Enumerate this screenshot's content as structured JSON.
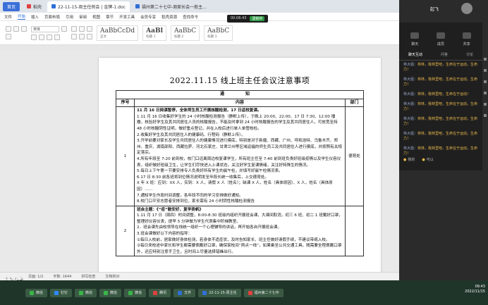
{
  "window": {
    "tabs": [
      {
        "label": "首页",
        "active": false,
        "color": "#3a6fd8"
      },
      {
        "label": "稻壳",
        "active": false,
        "color": "#e04040"
      },
      {
        "label": "22-11-15-周主任例会 | 金牌-1.doc",
        "active": true,
        "color": "#2f6fd8"
      },
      {
        "label": "福州第二十七中-周家长会一般主...",
        "active": false,
        "color": "#2f6fd8"
      }
    ],
    "menu": [
      "文件",
      "开始",
      "插入",
      "页面布局",
      "引用",
      "审阅",
      "视图",
      "章节",
      "开发工具",
      "会员专享",
      "稻壳资源",
      "查找命令"
    ],
    "active_menu": "开始",
    "font_name": "宋体",
    "styles": [
      {
        "sample": "AaBbCcDd",
        "label": "正文"
      },
      {
        "sample": "AaBl",
        "label": "标题 1"
      },
      {
        "sample": "AaBbC",
        "label": "标题 2"
      },
      {
        "sample": "AaBbC",
        "label": "标题 3"
      }
    ],
    "status": {
      "page": "页面: 1/2",
      "words": "字数: 1644",
      "check": "拼写检查",
      "mode": "文档校对"
    }
  },
  "document": {
    "title": "2022.11.15 线上班主任会议注意事项",
    "notice_header": "通 知",
    "columns": {
      "num": "序号",
      "content": "内容",
      "dept": "部门"
    },
    "rows": [
      {
        "num": "1",
        "dept": "德育处",
        "lines": [
          {
            "text": "11 月 16 日网课暂停，全体师生员工开展核酸检测，17 日返校复课。",
            "bold": true
          },
          {
            "text": "1.11 月 16 日收集好学生的 24 小时核酸检测报告（静默上传），于晚上 20:00、22:00、17 日 7:30、12:00 播撒，核验好学生及其共同居住人员的核酸报告，不能及时拿到 24 小时核酸报告的学生及其共同居住人，可放宽至持 48 小时核酸阴性证明，做好重点登记，并在入校后进行单人单管核检。",
            "bold": false
          },
          {
            "text": "2.收集好学生及其共同居住人的健康码、行程码（静默上传）。",
            "bold": false
          },
          {
            "text": "3.开学前要对家长及学生共同居住人的健康情况进行摸底，特别是对于新疆、西藏、广州、呼和浩特、乌鲁木齐、郑州、重庆、湖南邵阳、西藏拉萨、河北石家庄、甘肃兰州等区域返福的师生员工及共同居住人进行摸底，并按照有关规定落实。",
            "bold": false
          },
          {
            "text": "4.所有年段至 7:20 前到校，校门口远离周边校复课学生，所有班主任至 7:40 前到班负责好班级疫情以及学生仪容仪表，组织做好班级卫生，让学生们尽快进入上课状态，关注好学生复课情绪，关注好特殊生的情况。",
            "bold": false
          },
          {
            "text": "5.每日上下午第一节要安排专人负责好所有学生的晨午检，并填写好晨午检情况表。",
            "bold": false
          },
          {
            "text": "6.17 日 8:30 前各班将到位情况说明发至年段长统一收集后，上交德育处。",
            "bold": false
          },
          {
            "text": "X 年 X 班：应到：XX 人，实到：X 人，请假 X 人（姓名）；缺课 X 人，姓名（具体原因）、X 人，姓名（具体原因）……",
            "bold": false
          },
          {
            "text": "7.通知学生作息时间调整，各年段不同的学习安排做好通知。",
            "bold": false
          },
          {
            "text": "8.校门口平安志愿者安排到位，家长需有 24 小时阴性核酸检测报告",
            "bold": false
          }
        ]
      },
      {
        "num": "2",
        "dept": "",
        "lines": [
          {
            "text": "班会主题：《“疫”散安好，复学扬帆》",
            "bold": true
          },
          {
            "text": "1.11 月 17 日（周四）时间调整，8:00-8:30 班级内组织开展班会课，大课间取消，初三 6 班、初二 1 班戴好口罩，整理好仪容仪表，提早 5 分钟做为学生代表集中阶梯教室。",
            "bold": false
          },
          {
            "text": "2．班会课先由校领导在线统一组织一个心理辅导的讲话，再开始各自开展班会课。",
            "bold": false
          },
          {
            "text": "3.班会课做好以下内容的指导：",
            "bold": false
          },
          {
            "text": "①每日入校前，居家做好身体检测，若身体不适症状，及时告知家长、班主任做好请假手续，不建议带病入校。",
            "bold": false
          },
          {
            "text": "②每日来校途中家长和学生都需要佩戴好口罩，确保家校间“两点一线”，如果乘坐公共交通工具，随需要全程佩戴口罩外，还应特别注意手卫生，且时间上尽量选择错峰出行。",
            "bold": false
          }
        ]
      }
    ]
  },
  "overlay": {
    "speaker_name": "林城",
    "meeting_timer": "00:06:43",
    "rec_label": "录制中",
    "top_speaker": "起飞"
  },
  "side_panel": {
    "icons": [
      {
        "label": "聊天",
        "icon": "chat-icon"
      },
      {
        "label": "成员",
        "icon": "members-icon"
      },
      {
        "label": "共享",
        "icon": "share-icon"
      }
    ],
    "tabs": [
      "聊天互动",
      "问答",
      "讨论"
    ],
    "active_tab": "聊天互动",
    "messages": [
      {
        "name": "林大姐：",
        "text": "林林，我林里吧，生命在于运动，生命力！"
      },
      {
        "name": "林大姐：",
        "text": "林林，我林里吧，生命在于运动，生命力！"
      },
      {
        "name": "林大姐：",
        "text": "林林，我林里吧，生命在于运动！"
      },
      {
        "name": "林大姐：",
        "text": "林林，我林里吧，生命在于运动，生命力！"
      },
      {
        "name": "林大姐：",
        "text": "林林，我林里吧，生命在于运动，生命力！"
      },
      {
        "name": "林大姐：",
        "text": "林林，我林里吧，生命在于运动，生命力！"
      },
      {
        "name": "林大姐：",
        "text": "林林，我林里吧，生命在于运动，生命力！"
      }
    ],
    "footer": [
      "我的",
      "可以"
    ]
  },
  "taskbar": {
    "items": [
      {
        "label": "微信",
        "color": "#3ab54a"
      },
      {
        "label": "钉钉",
        "color": "#2f87f7"
      },
      {
        "label": "微信",
        "color": "#3ab54a"
      },
      {
        "label": "微信",
        "color": "#3ab54a"
      },
      {
        "label": "微信",
        "color": "#3ab54a"
      },
      {
        "label": "腾讯",
        "color": "#e04040"
      },
      {
        "label": "文件",
        "color": "#2f6fd8"
      },
      {
        "label": "22-11-15-周主任",
        "color": "#2f6fd8"
      },
      {
        "label": "福州第二十七中",
        "color": "#e04040"
      }
    ],
    "time": "09:43",
    "date": "2022/11/15"
  }
}
